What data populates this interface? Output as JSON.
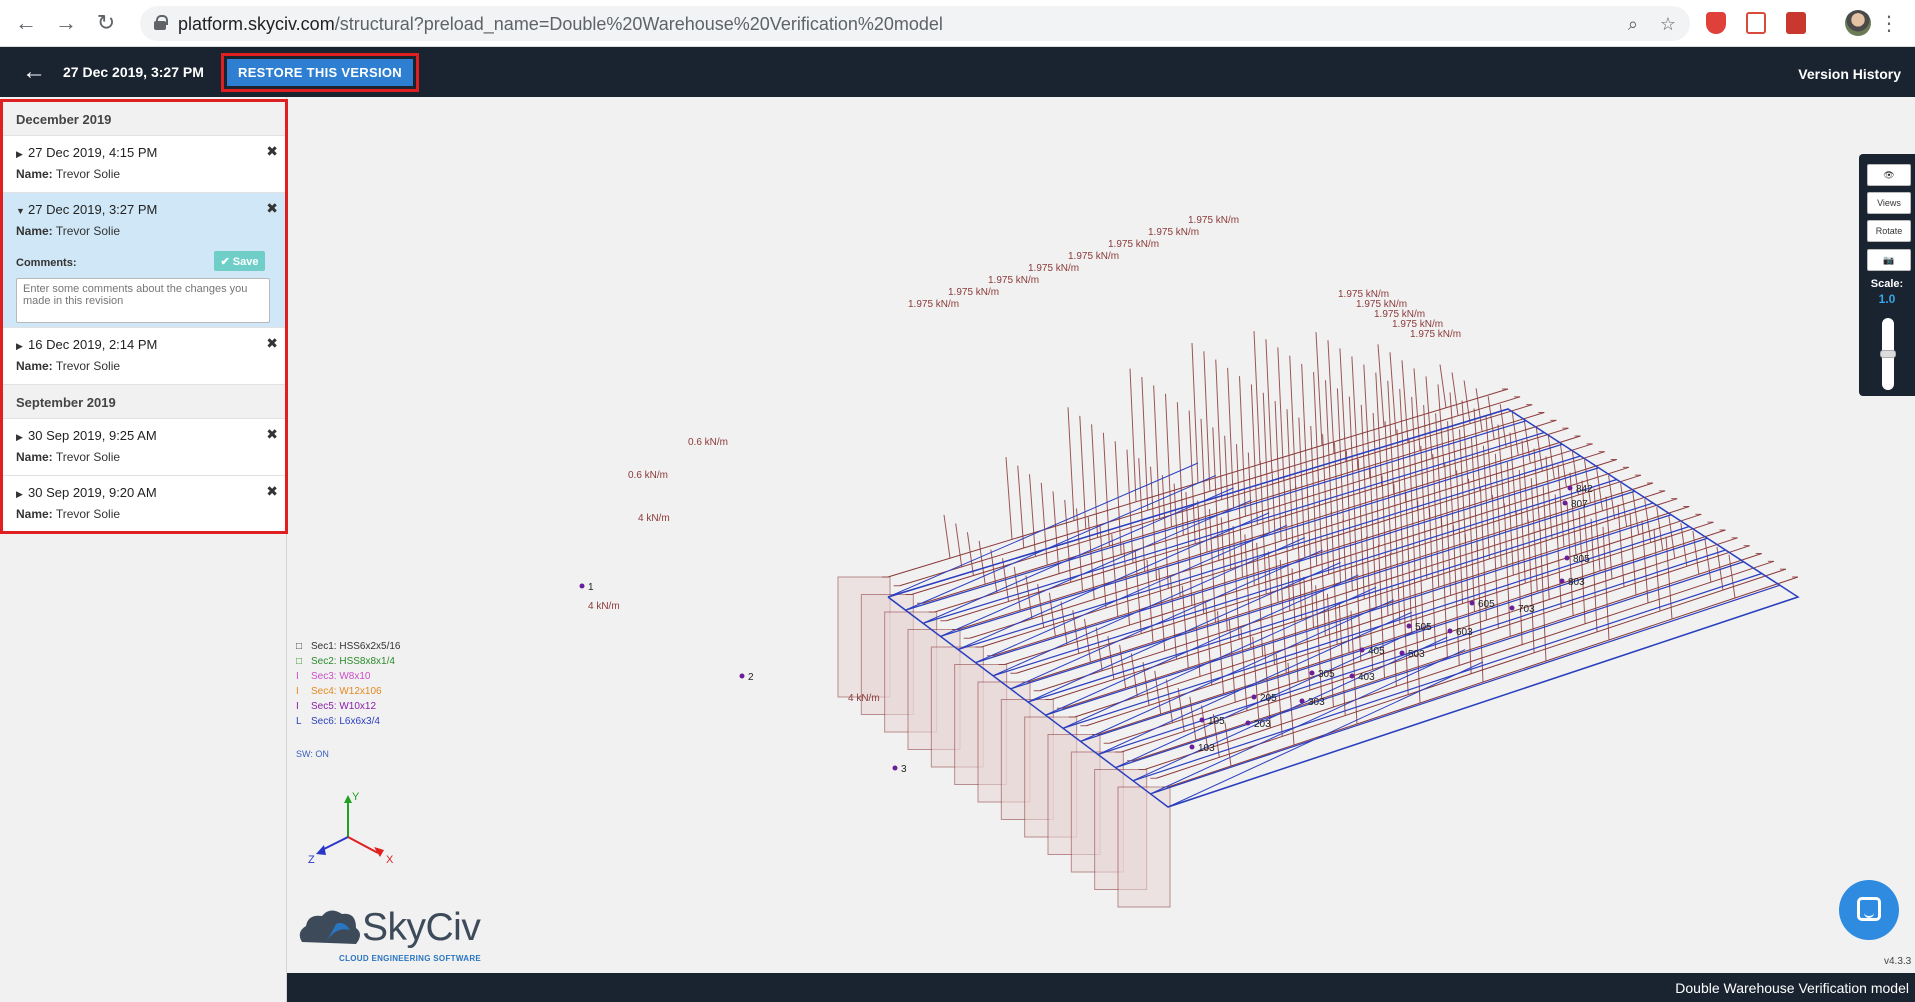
{
  "browser": {
    "url_host": "platform.skyciv.com",
    "url_path": "/structural?preload_name=Double%20Warehouse%20Verification%20model"
  },
  "header": {
    "current_version": "27 Dec 2019, 3:27 PM",
    "restore_label": "RESTORE THIS VERSION",
    "title": "Version History"
  },
  "sidebar": {
    "groups": [
      {
        "month": "December 2019",
        "versions": [
          {
            "date": "27 Dec 2019, 4:15 PM",
            "name_label": "Name:",
            "name": "Trevor Solie"
          },
          {
            "date": "27 Dec 2019, 3:27 PM",
            "name_label": "Name:",
            "name": "Trevor Solie",
            "comments_label": "Comments:",
            "save_label": "Save",
            "comment_placeholder": "Enter some comments about the changes you made in this revision"
          },
          {
            "date": "16 Dec 2019, 2:14 PM",
            "name_label": "Name:",
            "name": "Trevor Solie"
          }
        ]
      },
      {
        "month": "September 2019",
        "versions": [
          {
            "date": "30 Sep 2019, 9:25 AM",
            "name_label": "Name:",
            "name": "Trevor Solie"
          },
          {
            "date": "30 Sep 2019, 9:20 AM",
            "name_label": "Name:",
            "name": "Trevor Solie"
          }
        ]
      }
    ]
  },
  "legend": {
    "sections": [
      {
        "symbol": "□",
        "label": "Sec1: HSS6x2x5/16",
        "color": "#333333"
      },
      {
        "symbol": "□",
        "label": "Sec2: HSS8x8x1/4",
        "color": "#2a8a2a"
      },
      {
        "symbol": "I",
        "label": "Sec3: W8x10",
        "color": "#c94fc9"
      },
      {
        "symbol": "I",
        "label": "Sec4: W12x106",
        "color": "#e38a1e"
      },
      {
        "symbol": "I",
        "label": "Sec5: W10x12",
        "color": "#8a1fa8"
      },
      {
        "symbol": "L",
        "label": "Sec6: L6x6x3/4",
        "color": "#2b3fbf"
      }
    ],
    "self_weight": "SW: ON"
  },
  "axes": {
    "x": "X",
    "y": "Y",
    "z": "Z"
  },
  "model_labels": {
    "load_large": "1.975 kN/m",
    "load_small": "0.6 kN/m",
    "load_side": "4 kN/m",
    "node_numbers": [
      "842",
      "807",
      "805",
      "803",
      "703",
      "605",
      "603",
      "505",
      "503",
      "405",
      "403",
      "305",
      "303",
      "205",
      "203",
      "105",
      "103",
      "1",
      "2",
      "3"
    ]
  },
  "toolbar": {
    "views_label": "Views",
    "rotate_label": "Rotate",
    "scale_label": "Scale:",
    "scale_value": "1.0",
    "scale_fraction": 0.5
  },
  "logo": {
    "name": "SkyCiv",
    "tagline": "CLOUD ENGINEERING SOFTWARE"
  },
  "footer": {
    "version": "v4.3.3",
    "model_name": "Double Warehouse Verification model"
  },
  "colors": {
    "header_bg": "#1a2431",
    "accent": "#2e7fd1",
    "highlight_frame": "#e02020",
    "selected_row": "#cfe7f6",
    "load": "#8b3a3a",
    "member_blue": "#2b3fbf"
  }
}
